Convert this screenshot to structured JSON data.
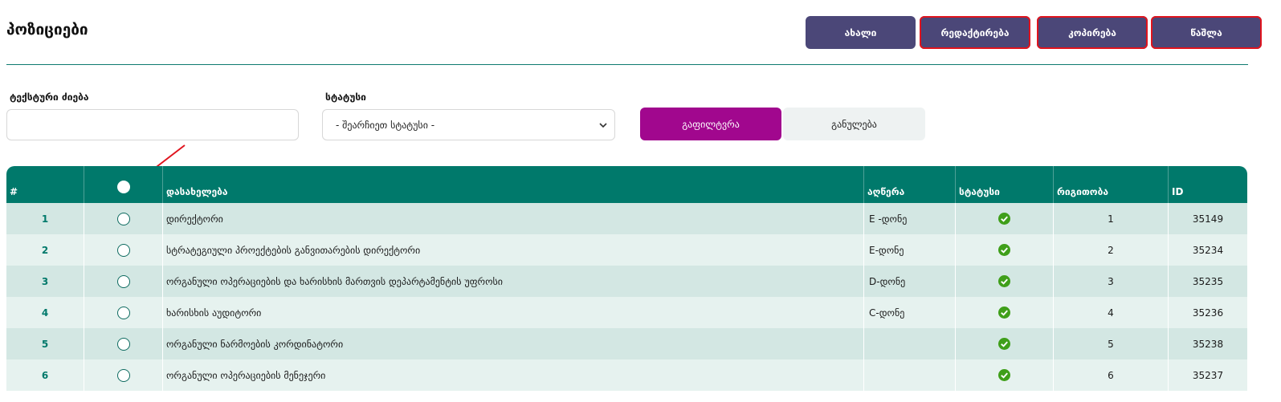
{
  "page": {
    "title": "პოზიციები"
  },
  "toolbar": {
    "new_label": "ახალი",
    "edit_label": "რედაქტირება",
    "copy_label": "კოპირება",
    "delete_label": "წაშლა"
  },
  "filters": {
    "search_label": "ტექსტური ძიება",
    "search_value": "",
    "status_label": "სტატუსი",
    "status_selected": "- შეარჩიეთ სტატუსი -",
    "filter_button": "გაფილტვრა",
    "reset_button": "განულება"
  },
  "colors": {
    "primary_button": "#4b4778",
    "filter_button": "#a1078e",
    "table_header": "#00796b",
    "highlight_outline": "#e0141e",
    "status_active": "#3f9f1a"
  },
  "table": {
    "columns": [
      "#",
      "",
      "დასახელება",
      "აღწერა",
      "სტატუსი",
      "რიგითობა",
      "ID"
    ],
    "rows": [
      {
        "num": "1",
        "name": "დირექტორი",
        "desc": "E -დონე",
        "status": "check-circle-icon",
        "order": "1",
        "id": "35149"
      },
      {
        "num": "2",
        "name": "სტრატეგიული პროექტების განვითარების დირექტორი",
        "desc": "E-დონე",
        "status": "check-circle-icon",
        "order": "2",
        "id": "35234"
      },
      {
        "num": "3",
        "name": "ორგანული ოპერაციების და ხარისხის მართვის დეპარტამენტის უფროსი",
        "desc": "D-დონე",
        "status": "check-circle-icon",
        "order": "3",
        "id": "35235"
      },
      {
        "num": "4",
        "name": "ხარისხის აუდიტორი",
        "desc": "C-დონე",
        "status": "check-circle-icon",
        "order": "4",
        "id": "35236"
      },
      {
        "num": "5",
        "name": "ორგანული ნარმოების კორდინატორი",
        "desc": "",
        "status": "check-circle-icon",
        "order": "5",
        "id": "35238"
      },
      {
        "num": "6",
        "name": "ორგანული ოპერაციების მენეჯერი",
        "desc": "",
        "status": "check-circle-icon",
        "order": "6",
        "id": "35237"
      }
    ]
  }
}
